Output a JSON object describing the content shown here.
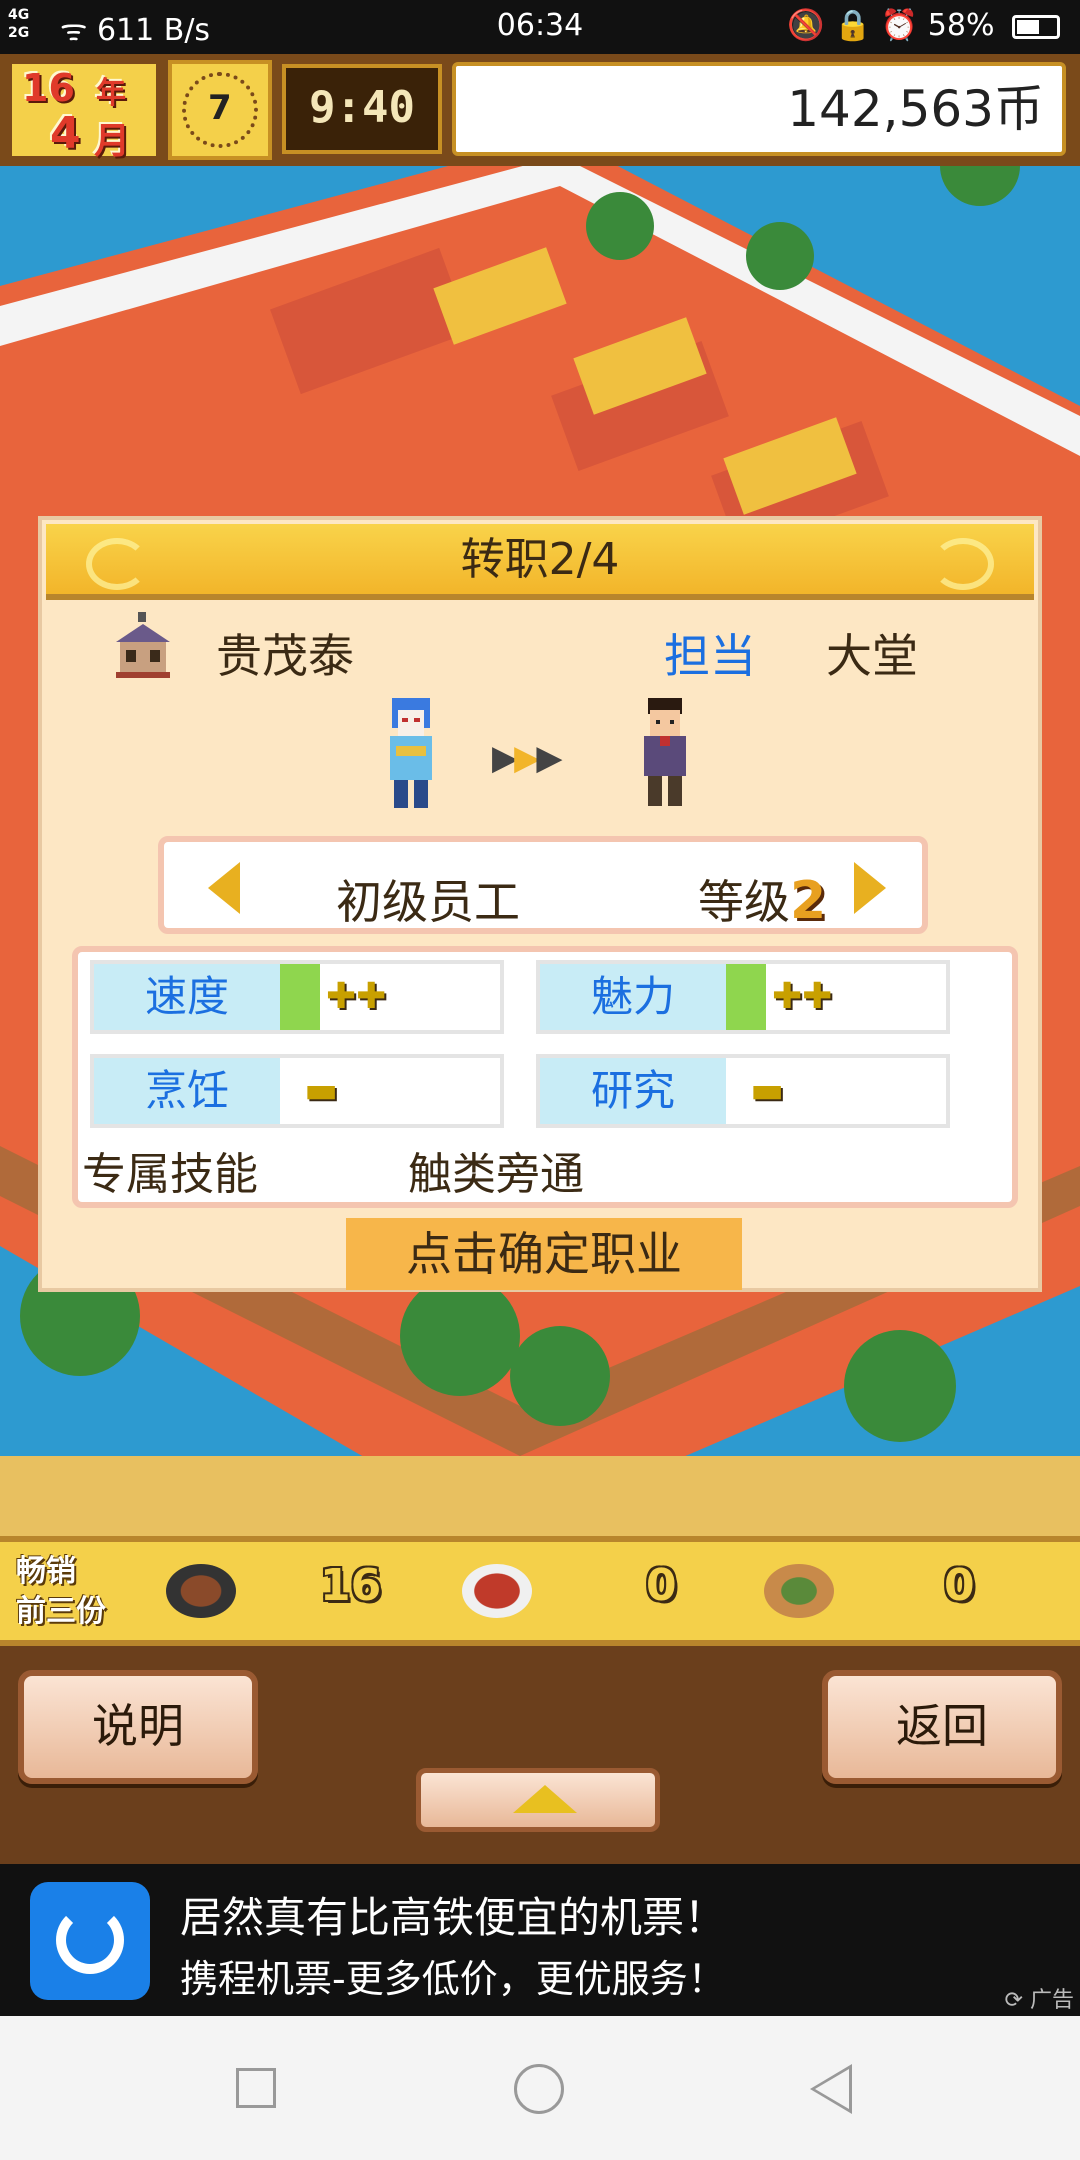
{
  "status_bar": {
    "signal": "4G\n2G",
    "net_speed": "611 B/s",
    "time": "06:34",
    "battery": "58%",
    "battery_level": 0.58
  },
  "top_bar": {
    "year": "16",
    "year_unit": "年",
    "month": "4",
    "month_unit": "月",
    "clock_hour": "7",
    "game_time": "9:40",
    "money": "142,563币"
  },
  "dialog": {
    "title": "转职2/4",
    "employee_name": "贵茂泰",
    "assignment_label": "担当",
    "department": "大堂",
    "job": {
      "name": "初级员工",
      "grade_label": "等级",
      "grade_value": "2"
    },
    "stats": [
      {
        "label": "速度",
        "value": "✚✚",
        "has_bar": true
      },
      {
        "label": "魅力",
        "value": "✚✚",
        "has_bar": true
      },
      {
        "label": "烹饪",
        "value": "▬",
        "has_bar": false
      },
      {
        "label": "研究",
        "value": "▬",
        "has_bar": false
      }
    ],
    "skill_label": "专属技能",
    "skill_value": "触类旁通",
    "confirm_label": "点击确定职业"
  },
  "bestseller": {
    "label_line1": "畅销",
    "label_line2": "前三份",
    "items": [
      {
        "icon": "hotpot-dish-icon",
        "count": "16"
      },
      {
        "icon": "meat-dish-icon",
        "count": "0"
      },
      {
        "icon": "basket-dish-icon",
        "count": "0"
      }
    ]
  },
  "bottom_buttons": {
    "help_label": "说明",
    "back_label": "返回"
  },
  "ad": {
    "title": "居然真有比高铁便宜的机票！",
    "subtitle": "携程机票-更多低价，更优服务！",
    "tag": "广告"
  },
  "colors": {
    "accent_blue": "#1b6fe0",
    "dialog_bg": "#fde7c4",
    "title_gold": "#f2b52a",
    "confirm_orange": "#f7b64a"
  }
}
